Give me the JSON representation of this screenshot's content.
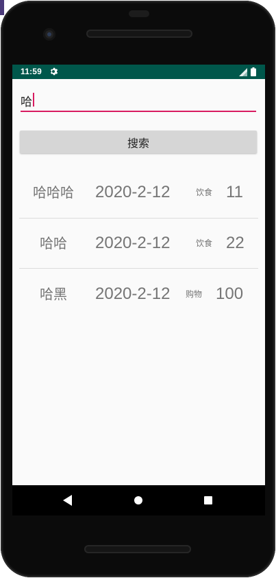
{
  "status_bar": {
    "time": "11:59",
    "icons": [
      "gear-icon",
      "signal-icon",
      "battery-icon"
    ],
    "color": "#00574b"
  },
  "search": {
    "value": "哈",
    "accent_color": "#d81b60"
  },
  "search_button": {
    "label": "搜索"
  },
  "records": [
    {
      "name": "哈哈哈",
      "date": "2020-2-12",
      "category": "饮食",
      "amount": "11"
    },
    {
      "name": "哈哈",
      "date": "2020-2-12",
      "category": "饮食",
      "amount": "22"
    },
    {
      "name": "哈黑",
      "date": "2020-2-12",
      "category": "购物",
      "amount": "100"
    }
  ],
  "nav_bar": {
    "buttons": [
      "back-icon",
      "home-icon",
      "recents-icon"
    ]
  }
}
